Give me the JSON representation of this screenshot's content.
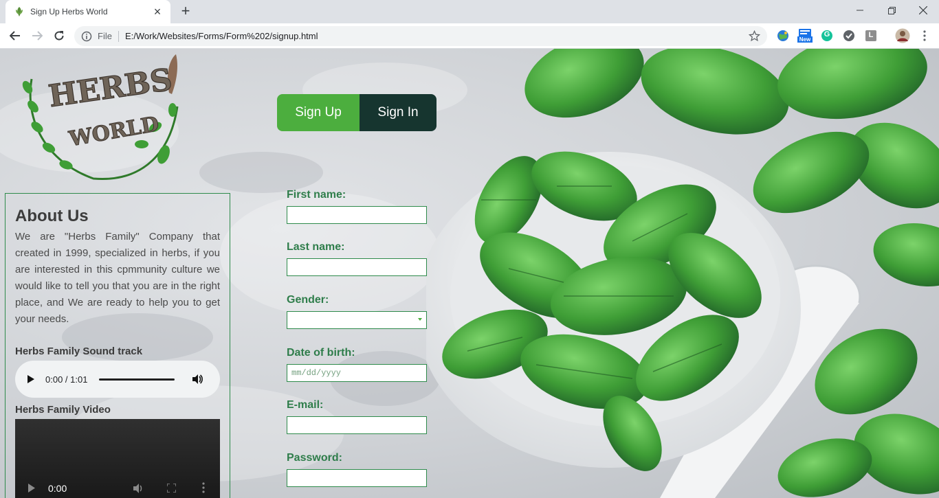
{
  "browser": {
    "tab_title": "Sign Up Herbs World",
    "tab_close": "×",
    "new_tab": "+",
    "file_label": "File",
    "url": "E:/Work/Websites/Forms/Form%202/signup.html",
    "ext_new_badge": "New",
    "ext_l_label": "L",
    "ext_g_label": "G"
  },
  "page": {
    "logo_text": [
      "HERBS",
      "WORLD"
    ],
    "auth": {
      "signup_label": "Sign Up",
      "signin_label": "Sign In"
    },
    "about": {
      "title": "About Us",
      "text": "We are \"Herbs Family\" Company that created in 1999, specialized in herbs, if you are interested in this cpmmunity culture we would like to tell you that you are in the right place, and We are ready to help you to get your needs.",
      "sound_heading": "Herbs Family Sound track",
      "audio_time": "0:00 / 1:01",
      "video_heading": "Herbs Family Video",
      "video_time": "0:00"
    },
    "form": {
      "first_name_label": "First name:",
      "last_name_label": "Last name:",
      "gender_label": "Gender:",
      "dob_label": "Date of birth:",
      "dob_placeholder": "mm/dd/yyyy",
      "email_label": "E-mail:",
      "password_label": "Password:"
    }
  },
  "colors": {
    "accent_green": "#4cae3e",
    "dark_green": "#16352f",
    "label_green": "#2e7d4a"
  }
}
